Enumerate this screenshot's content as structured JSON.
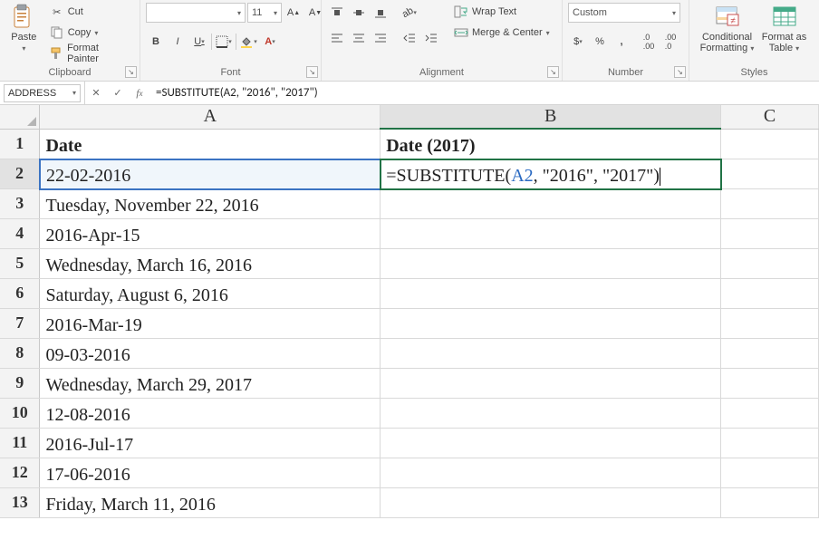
{
  "ribbon": {
    "clipboard": {
      "paste": "Paste",
      "cut": "Cut",
      "copy": "Copy",
      "format_painter": "Format Painter",
      "title": "Clipboard"
    },
    "font": {
      "name_value": "",
      "size_value": "11",
      "title": "Font"
    },
    "alignment": {
      "wrap": "Wrap Text",
      "merge": "Merge & Center",
      "title": "Alignment"
    },
    "number": {
      "format": "Custom",
      "title": "Number"
    },
    "styles": {
      "conditional": "Conditional\nFormatting",
      "table": "Format as\nTable",
      "title": "Styles"
    }
  },
  "fx": {
    "namebox": "ADDRESS",
    "formula": "=SUBSTITUTE(A2, \"2016\", \"2017\")"
  },
  "columns": [
    "A",
    "B",
    "C"
  ],
  "grid": {
    "A1": "Date",
    "B1": "Date (2017)",
    "A2": "22-02-2016",
    "B2_prefix": "=SUBSTITUTE(",
    "B2_ref": "A2",
    "B2_suffix": ", \"2016\", \"2017\")",
    "A3": "Tuesday, November 22, 2016",
    "A4": "2016-Apr-15",
    "A5": "Wednesday, March 16, 2016",
    "A6": "Saturday, August 6, 2016",
    "A7": "2016-Mar-19",
    "A8": "09-03-2016",
    "A9": "Wednesday, March 29, 2017",
    "A10": "12-08-2016",
    "A11": "2016-Jul-17",
    "A12": "17-06-2016",
    "A13": "Friday, March 11, 2016"
  }
}
